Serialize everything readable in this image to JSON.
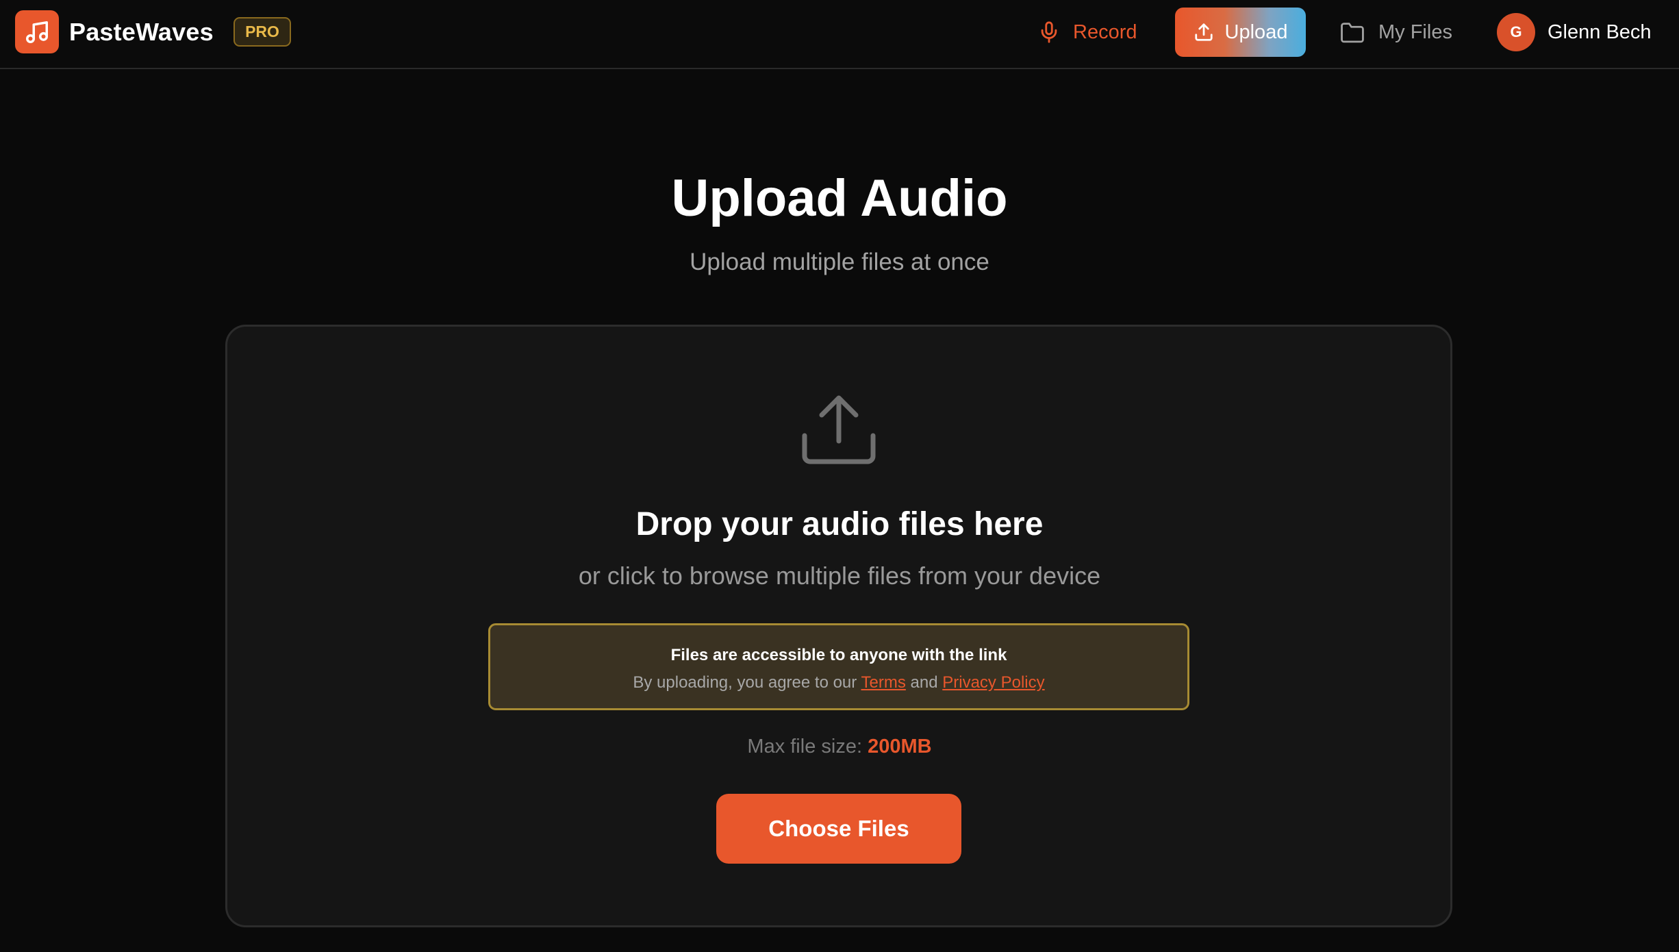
{
  "nav": {
    "brand": "PasteWaves",
    "badge": "PRO",
    "record_label": "Record",
    "upload_label": "Upload",
    "files_label": "My Files",
    "user_initial": "G",
    "user_name": "Glenn Bech"
  },
  "header": {
    "title": "Upload Audio",
    "subtitle": "Upload multiple files at once"
  },
  "dropzone": {
    "title": "Drop your audio files here",
    "subtitle": "or click to browse multiple files from your device",
    "notice": {
      "title": "Files are accessible to anyone with the link",
      "prefix": "By uploading, you agree to our",
      "terms_label": "Terms",
      "and": "and",
      "privacy_label": "Privacy Policy"
    },
    "max_size_label": "Max file size:",
    "max_size_value": "200MB",
    "choose_label": "Choose Files"
  },
  "icons": {
    "logo": "music-note-icon",
    "record": "microphone-icon",
    "upload": "upload-icon",
    "files": "folder-icon",
    "drop": "upload-tray-icon"
  },
  "colors": {
    "accent": "#e8572c",
    "badge_text": "#e9b949",
    "notice_border": "#a78b33",
    "background": "#0a0a0a",
    "panel": "#151515"
  }
}
